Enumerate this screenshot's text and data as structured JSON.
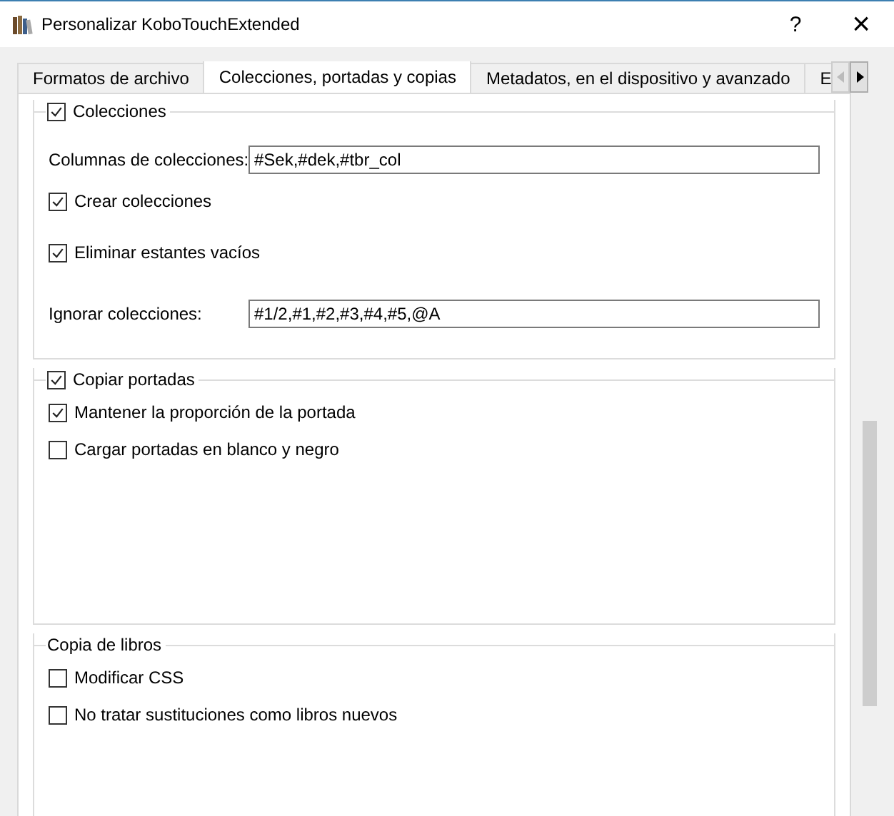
{
  "window": {
    "title": "Personalizar KoboTouchExtended",
    "help": "?",
    "close": "×"
  },
  "tabs": [
    {
      "label": "Formatos de archivo",
      "selected": false
    },
    {
      "label": "Colecciones, portadas y copias",
      "selected": true
    },
    {
      "label": "Metadatos, en el dispositivo y avanzado",
      "selected": false
    },
    {
      "label": "E",
      "selected": false
    }
  ],
  "groups": [
    {
      "title": "Colecciones",
      "kind": "checkable",
      "checked": true,
      "items": [
        {
          "kind": "field",
          "label": "Columnas de colecciones:",
          "value": "#Sek,#dek,#tbr_col"
        },
        {
          "kind": "checkbox",
          "label": "Crear colecciones",
          "checked": true
        },
        {
          "kind": "checkbox",
          "label": "Eliminar estantes vacíos",
          "checked": true
        },
        {
          "kind": "field",
          "label": "Ignorar colecciones:",
          "value": "#1/2,#1,#2,#3,#4,#5,@A"
        }
      ]
    },
    {
      "title": "Copiar portadas",
      "kind": "checkable",
      "checked": true,
      "items": [
        {
          "kind": "checkbox",
          "label": "Mantener la proporción de la portada",
          "checked": true
        },
        {
          "kind": "checkbox",
          "label": "Cargar portadas en blanco y negro",
          "checked": false
        }
      ]
    },
    {
      "title": "Copia de libros",
      "kind": "plain",
      "items": [
        {
          "kind": "checkbox",
          "label": "Modificar CSS",
          "checked": false
        },
        {
          "kind": "checkbox",
          "label": "No tratar sustituciones como libros nuevos",
          "checked": false
        }
      ]
    }
  ]
}
